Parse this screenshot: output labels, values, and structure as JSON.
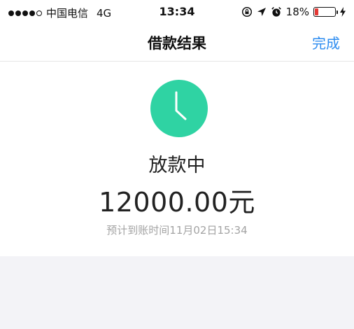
{
  "status_bar": {
    "carrier": "中国电信",
    "network": "4G",
    "time": "13:34",
    "battery_percent": "18%",
    "battery_level": 0.18,
    "icons": [
      "lock-rotation-icon",
      "location-arrow-icon",
      "alarm-icon",
      "charging-bolt-icon"
    ]
  },
  "nav": {
    "title": "借款结果",
    "done_label": "完成"
  },
  "result": {
    "icon": "clock-icon",
    "icon_color": "#2fd3a3",
    "status": "放款中",
    "amount": "12000.00元",
    "eta": "预计到账时间11月02日15:34"
  },
  "colors": {
    "accent": "#2d8cf0",
    "battery_low": "#e53935",
    "gray_area": "#f3f3f7"
  }
}
